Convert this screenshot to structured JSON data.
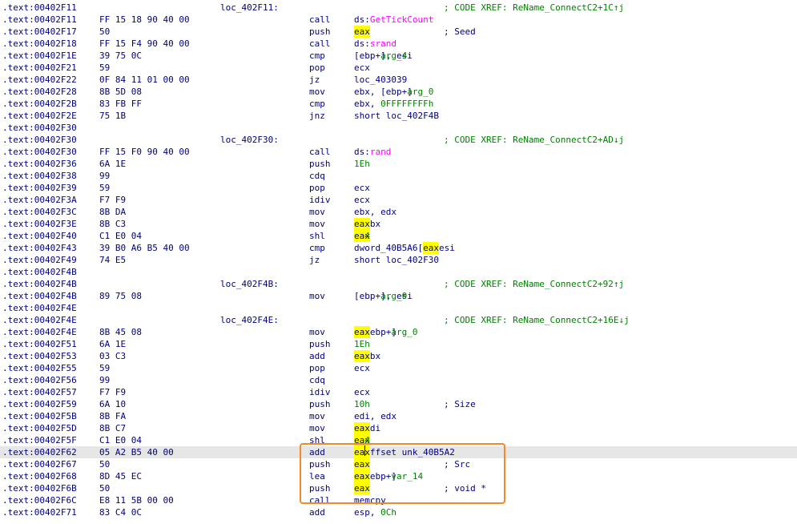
{
  "lines": [
    {
      "addr": ".text:00402F11",
      "bytes": "",
      "label": "loc_402F11:",
      "parts": [],
      "comment": "; CODE XREF: ReName_ConnectC2+1C↑j"
    },
    {
      "addr": ".text:00402F11",
      "bytes": "FF 15 18 90 40 00",
      "mnemonic": "call",
      "operand": "ds:GetTickCount"
    },
    {
      "addr": ".text:00402F17",
      "bytes": "50",
      "mnemonic": "push",
      "operand": "eax",
      "comment": "; Seed"
    },
    {
      "addr": ".text:00402F18",
      "bytes": "FF 15 F4 90 40 00",
      "mnemonic": "call",
      "operand": "ds:srand"
    },
    {
      "addr": ".text:00402F1E",
      "bytes": "39 75 0C",
      "mnemonic": "cmp",
      "operand": "[ebp+arg_4], esi"
    },
    {
      "addr": ".text:00402F21",
      "bytes": "59",
      "mnemonic": "pop",
      "operand": "ecx"
    },
    {
      "addr": ".text:00402F22",
      "bytes": "0F 84 11 01 00 00",
      "mnemonic": "jz",
      "operand": "loc_403039"
    },
    {
      "addr": ".text:00402F28",
      "bytes": "8B 5D 08",
      "mnemonic": "mov",
      "operand": "ebx, [ebp+arg_0]"
    },
    {
      "addr": ".text:00402F2B",
      "bytes": "83 FB FF",
      "mnemonic": "cmp",
      "operand": "ebx, 0FFFFFFFFh"
    },
    {
      "addr": ".text:00402F2E",
      "bytes": "75 1B",
      "mnemonic": "jnz",
      "operand": "short loc_402F4B"
    },
    {
      "addr": ".text:00402F30"
    },
    {
      "addr": ".text:00402F30",
      "label": "loc_402F30:",
      "comment": "; CODE XREF: ReName_ConnectC2+AD↓j"
    },
    {
      "addr": ".text:00402F30",
      "bytes": "FF 15 F0 90 40 00",
      "mnemonic": "call",
      "operand": "ds:rand"
    },
    {
      "addr": ".text:00402F36",
      "bytes": "6A 1E",
      "mnemonic": "push",
      "operand": "1Eh"
    },
    {
      "addr": ".text:00402F38",
      "bytes": "99",
      "mnemonic": "cdq",
      "operand": ""
    },
    {
      "addr": ".text:00402F39",
      "bytes": "59",
      "mnemonic": "pop",
      "operand": "ecx"
    },
    {
      "addr": ".text:00402F3A",
      "bytes": "F7 F9",
      "mnemonic": "idiv",
      "operand": "ecx"
    },
    {
      "addr": ".text:00402F3C",
      "bytes": "8B DA",
      "mnemonic": "mov",
      "operand": "ebx, edx"
    },
    {
      "addr": ".text:00402F3E",
      "bytes": "8B C3",
      "mnemonic": "mov",
      "operand": "eax, ebx"
    },
    {
      "addr": ".text:00402F40",
      "bytes": "C1 E0 04",
      "mnemonic": "shl",
      "operand": "eax, 4"
    },
    {
      "addr": ".text:00402F43",
      "bytes": "39 B0 A6 B5 40 00",
      "mnemonic": "cmp",
      "operand": "dword_40B5A6[eax], esi"
    },
    {
      "addr": ".text:00402F49",
      "bytes": "74 E5",
      "mnemonic": "jz",
      "operand": "short loc_402F30"
    },
    {
      "addr": ".text:00402F4B"
    },
    {
      "addr": ".text:00402F4B",
      "label": "loc_402F4B:",
      "comment": "; CODE XREF: ReName_ConnectC2+92↑j"
    },
    {
      "addr": ".text:00402F4B",
      "bytes": "89 75 08",
      "mnemonic": "mov",
      "operand": "[ebp+arg_0], esi"
    },
    {
      "addr": ".text:00402F4E"
    },
    {
      "addr": ".text:00402F4E",
      "label": "loc_402F4E:",
      "comment": "; CODE XREF: ReName_ConnectC2+16E↓j"
    },
    {
      "addr": ".text:00402F4E",
      "bytes": "8B 45 08",
      "mnemonic": "mov",
      "operand": "eax, [ebp+arg_0]"
    },
    {
      "addr": ".text:00402F51",
      "bytes": "6A 1E",
      "mnemonic": "push",
      "operand": "1Eh"
    },
    {
      "addr": ".text:00402F53",
      "bytes": "03 C3",
      "mnemonic": "add",
      "operand": "eax, ebx"
    },
    {
      "addr": ".text:00402F55",
      "bytes": "59",
      "mnemonic": "pop",
      "operand": "ecx"
    },
    {
      "addr": ".text:00402F56",
      "bytes": "99",
      "mnemonic": "cdq",
      "operand": ""
    },
    {
      "addr": ".text:00402F57",
      "bytes": "F7 F9",
      "mnemonic": "idiv",
      "operand": "ecx"
    },
    {
      "addr": ".text:00402F59",
      "bytes": "6A 10",
      "mnemonic": "push",
      "operand": "10h",
      "comment": "; Size"
    },
    {
      "addr": ".text:00402F5B",
      "bytes": "8B FA",
      "mnemonic": "mov",
      "operand": "edi, edx"
    },
    {
      "addr": ".text:00402F5D",
      "bytes": "8B C7",
      "mnemonic": "mov",
      "operand": "eax, edi"
    },
    {
      "addr": ".text:00402F5F",
      "bytes": "C1 E0 04",
      "mnemonic": "shl",
      "operand": "eax, 4"
    },
    {
      "addr": ".text:00402F62",
      "bytes": "05 A2 B5 40 00",
      "mnemonic": "add",
      "operand": "eax, offset unk_40B5A2",
      "selected": true
    },
    {
      "addr": ".text:00402F67",
      "bytes": "50",
      "mnemonic": "push",
      "operand": "eax",
      "comment": "; Src"
    },
    {
      "addr": ".text:00402F68",
      "bytes": "8D 45 EC",
      "mnemonic": "lea",
      "operand": "eax, [ebp+var_14]"
    },
    {
      "addr": ".text:00402F6B",
      "bytes": "50",
      "mnemonic": "push",
      "operand": "eax",
      "comment": "; void *"
    },
    {
      "addr": ".text:00402F6C",
      "bytes": "E8 11 5B 00 00",
      "mnemonic": "call",
      "operand": "memcpy"
    },
    {
      "addr": ".text:00402F71",
      "bytes": "83 C4 0C",
      "mnemonic": "add",
      "operand": "esp, 0Ch"
    }
  ],
  "colors": {
    "text": "#000080",
    "comment": "#008000",
    "api": "#ff00ff",
    "highlight": "#ffff00",
    "selected_row": "#e6e6e6",
    "frame": "#f28a2a"
  }
}
